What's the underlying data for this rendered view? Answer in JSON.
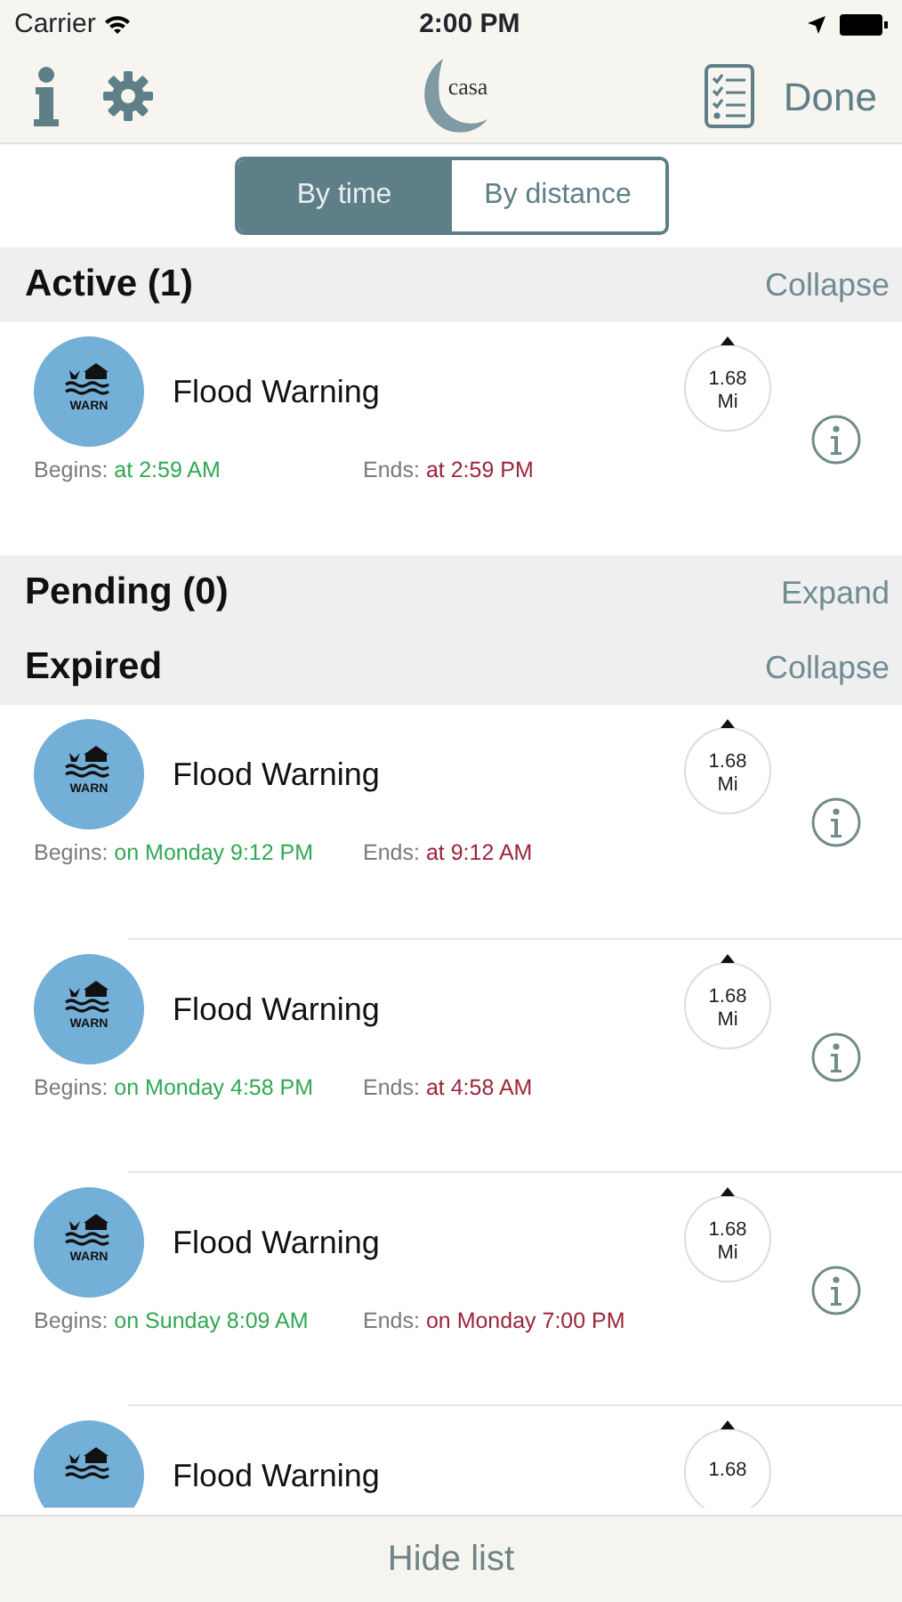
{
  "status_bar": {
    "carrier": "Carrier",
    "time": "2:00 PM"
  },
  "nav": {
    "logo": "casa",
    "done": "Done"
  },
  "segments": [
    {
      "label": "By time",
      "selected": true
    },
    {
      "label": "By distance",
      "selected": false
    }
  ],
  "sections": [
    {
      "title": "Active (1)",
      "action": "Collapse",
      "alerts": [
        {
          "title": "Flood Warning",
          "icon_label": "WARN",
          "distance": "1.68",
          "unit": "Mi",
          "begins_label": "Begins:",
          "begins": "at 2:59 AM",
          "ends_label": "Ends:",
          "ends": "at 2:59 PM"
        }
      ]
    },
    {
      "title": "Pending (0)",
      "action": "Expand"
    },
    {
      "title": "Expired",
      "action": "Collapse",
      "alerts": [
        {
          "title": "Flood Warning",
          "icon_label": "WARN",
          "distance": "1.68",
          "unit": "Mi",
          "begins_label": "Begins:",
          "begins": "on Monday 9:12 PM",
          "ends_label": "Ends:",
          "ends": "at 9:12 AM"
        },
        {
          "title": "Flood Warning",
          "icon_label": "WARN",
          "distance": "1.68",
          "unit": "Mi",
          "begins_label": "Begins:",
          "begins": "on Monday 4:58 PM",
          "ends_label": "Ends:",
          "ends": "at 4:58 AM"
        },
        {
          "title": "Flood Warning",
          "icon_label": "WARN",
          "distance": "1.68",
          "unit": "Mi",
          "begins_label": "Begins:",
          "begins": "on Sunday 8:09 AM",
          "ends_label": "Ends:",
          "ends": "on Monday 7:00 PM"
        },
        {
          "title": "Flood Warning",
          "distance": "1.68"
        }
      ]
    }
  ],
  "bottom_bar": {
    "label": "Hide list"
  }
}
